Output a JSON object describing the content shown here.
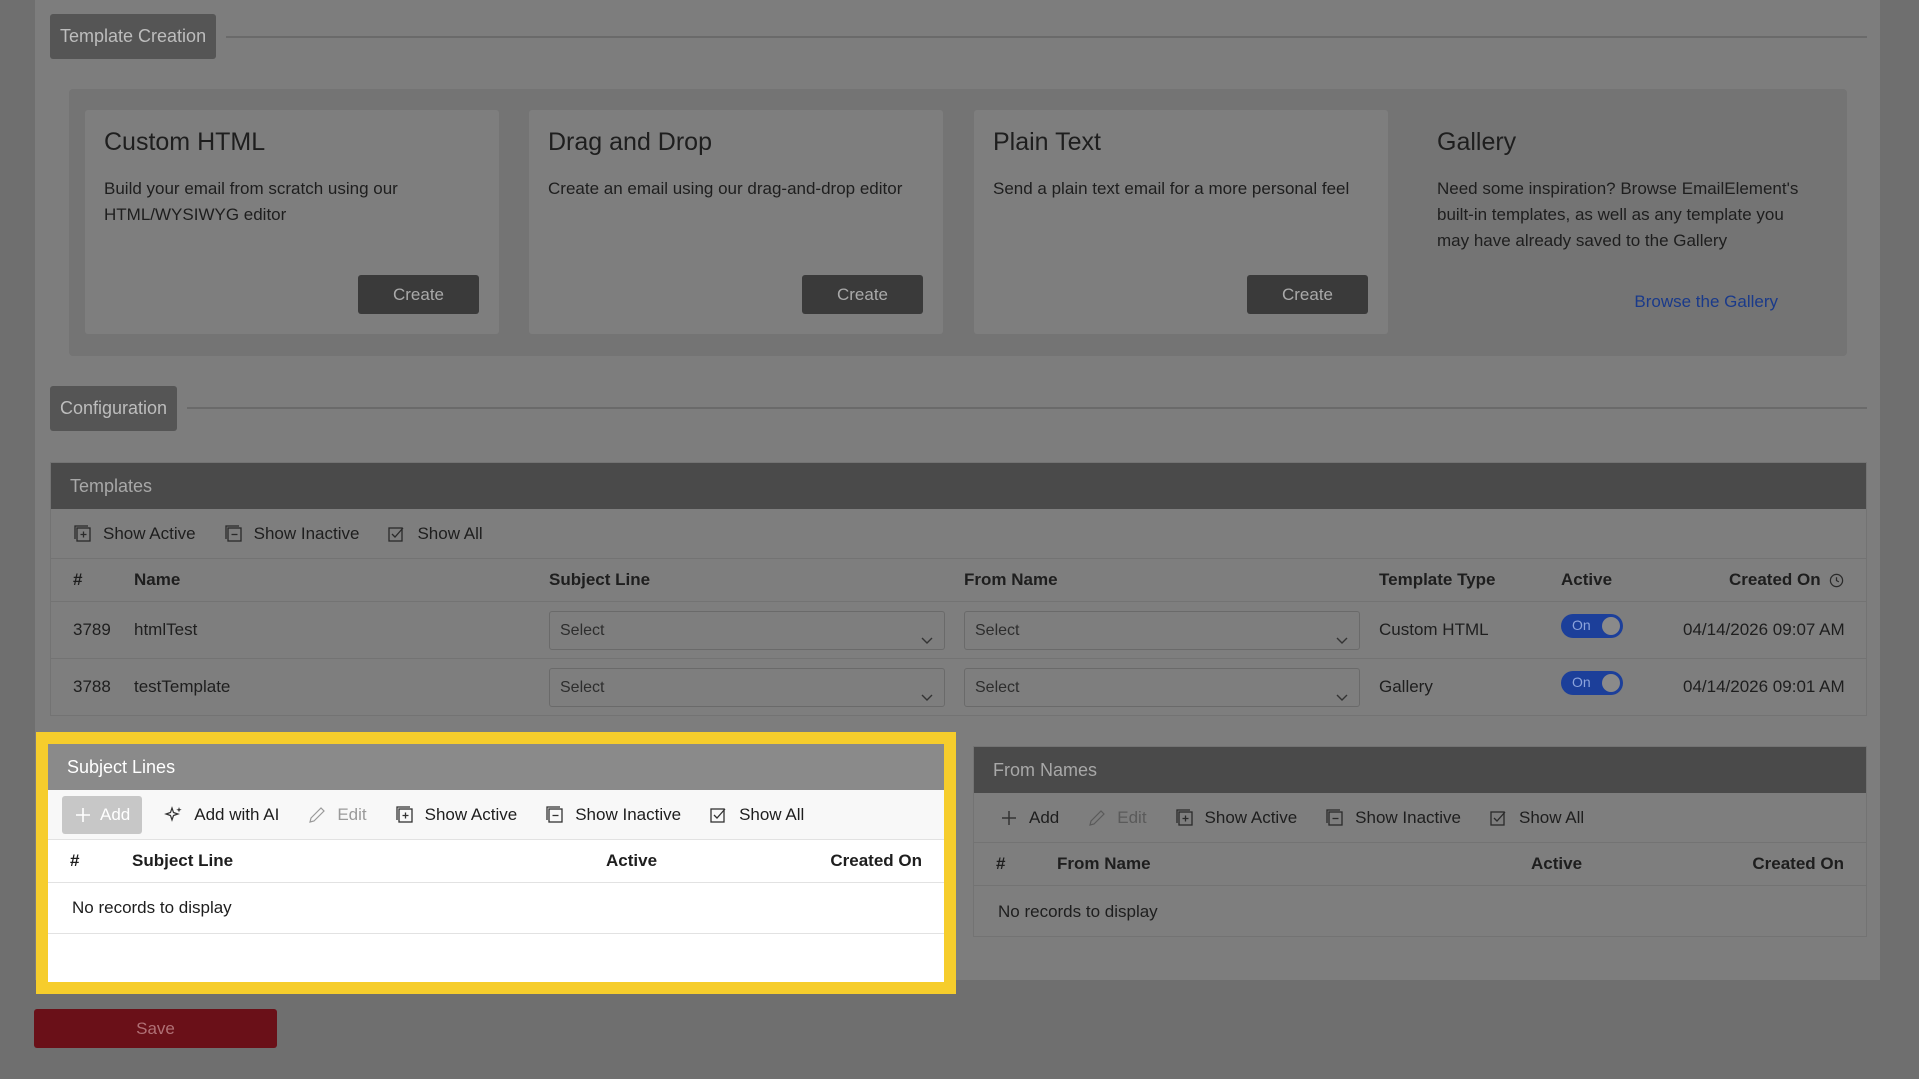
{
  "template_creation": {
    "heading": "Template Creation",
    "cards": [
      {
        "title": "Custom HTML",
        "description": "Build your email from scratch using our HTML/WYSIWYG editor",
        "button": "Create"
      },
      {
        "title": "Drag and Drop",
        "description": "Create an email using our drag-and-drop editor",
        "button": "Create"
      },
      {
        "title": "Plain Text",
        "description": "Send a plain text email for a more personal feel",
        "button": "Create"
      },
      {
        "title": "Gallery",
        "description": "Need some inspiration? Browse EmailElement's built-in templates, as well as any template you may have already saved to the Gallery",
        "link": "Browse the Gallery"
      }
    ]
  },
  "configuration": {
    "heading": "Configuration"
  },
  "templates": {
    "title": "Templates",
    "toolbar": {
      "show_active": "Show Active",
      "show_inactive": "Show Inactive",
      "show_all": "Show All"
    },
    "columns": {
      "num": "#",
      "name": "Name",
      "subject_line": "Subject Line",
      "from_name": "From Name",
      "template_type": "Template Type",
      "active": "Active",
      "created_on": "Created On"
    },
    "rows": [
      {
        "id": "3789",
        "name": "htmlTest",
        "subject": "Select",
        "from": "Select",
        "type": "Custom HTML",
        "active": "On",
        "created": "04/14/2026 09:07 AM"
      },
      {
        "id": "3788",
        "name": "testTemplate",
        "subject": "Select",
        "from": "Select",
        "type": "Gallery",
        "active": "On",
        "created": "04/14/2026 09:01 AM"
      }
    ]
  },
  "subject_lines": {
    "title": "Subject Lines",
    "toolbar": {
      "add": "Add",
      "add_ai": "Add with AI",
      "edit": "Edit",
      "show_active": "Show Active",
      "show_inactive": "Show Inactive",
      "show_all": "Show All"
    },
    "columns": {
      "num": "#",
      "subject_line": "Subject Line",
      "active": "Active",
      "created_on": "Created On"
    },
    "empty": "No records to display"
  },
  "from_names": {
    "title": "From Names",
    "toolbar": {
      "add": "Add",
      "edit": "Edit",
      "show_active": "Show Active",
      "show_inactive": "Show Inactive",
      "show_all": "Show All"
    },
    "columns": {
      "num": "#",
      "from_name": "From Name",
      "active": "Active",
      "created_on": "Created On"
    },
    "empty": "No records to display"
  },
  "save": {
    "label": "Save"
  },
  "colors": {
    "highlight": "#f6cd2c",
    "toggle_on": "#1c3f9a",
    "save": "#6a1018"
  }
}
